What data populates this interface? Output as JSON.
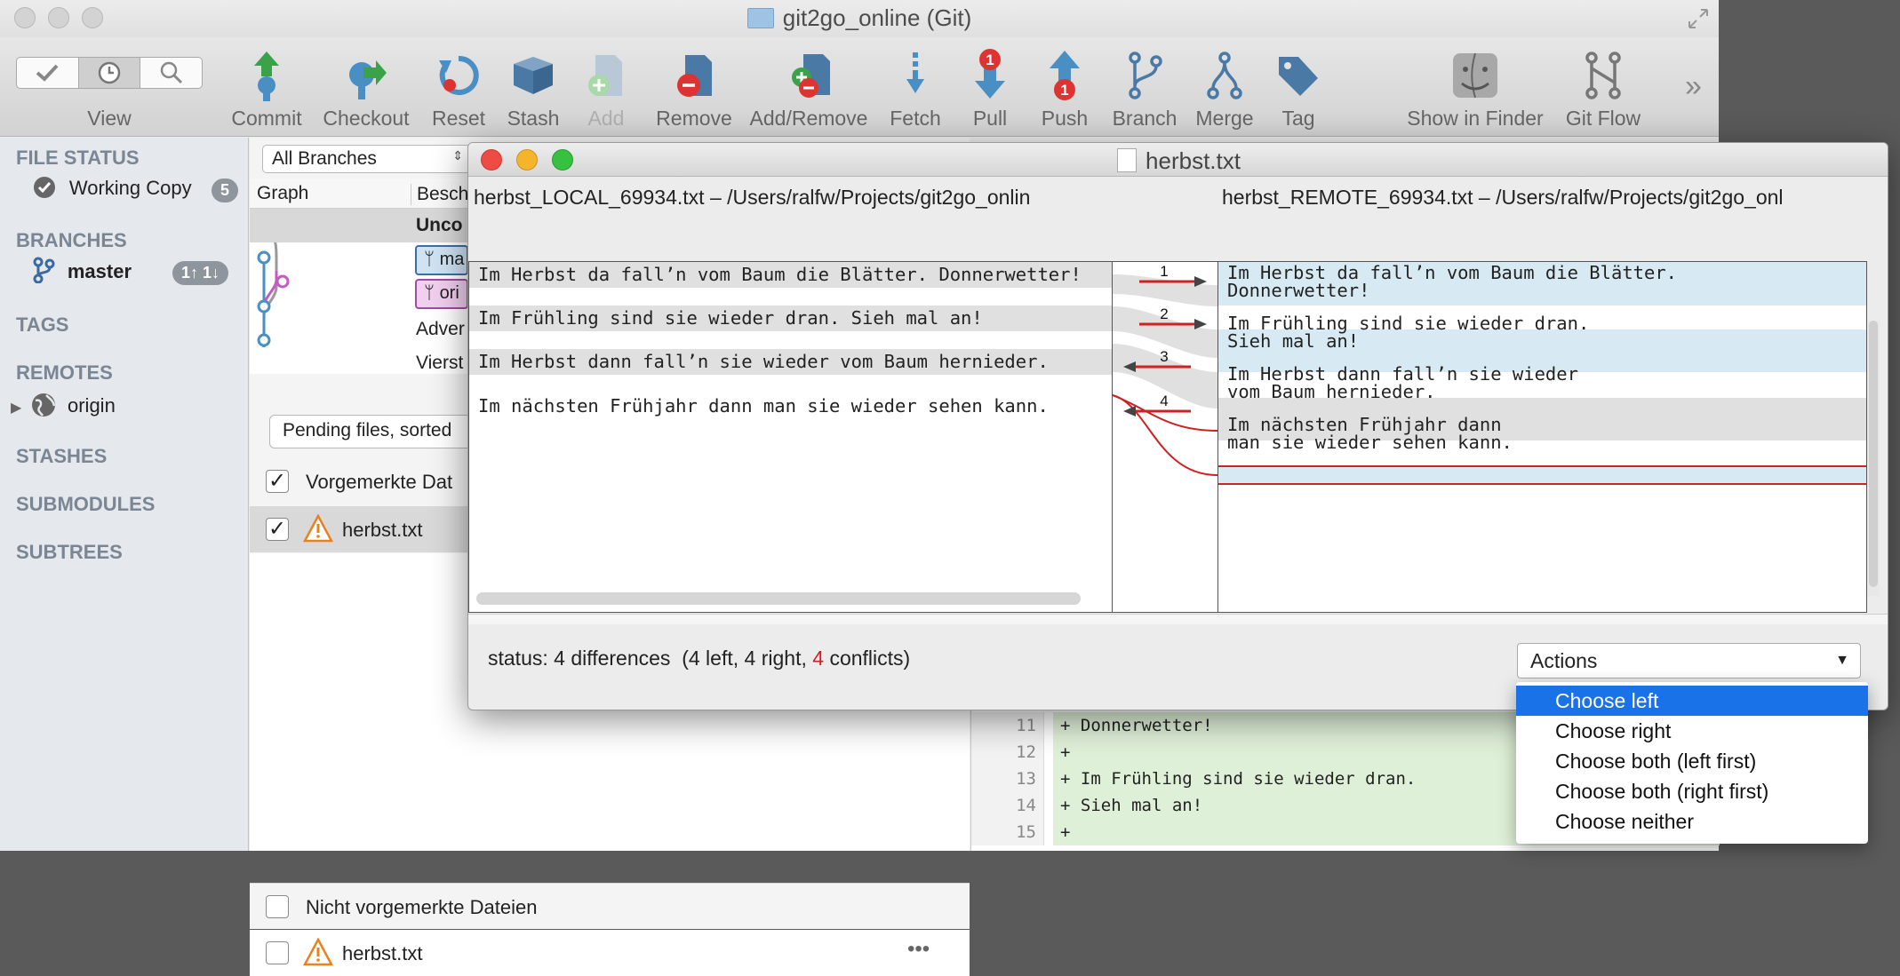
{
  "window": {
    "title": "git2go_online (Git)"
  },
  "toolbar": {
    "view_label": "View",
    "commit": "Commit",
    "checkout": "Checkout",
    "reset": "Reset",
    "stash": "Stash",
    "add": "Add",
    "remove": "Remove",
    "add_remove": "Add/Remove",
    "fetch": "Fetch",
    "pull": "Pull",
    "pull_badge": "1",
    "push": "Push",
    "push_badge": "1",
    "branch": "Branch",
    "merge": "Merge",
    "tag": "Tag",
    "show_in_finder": "Show in Finder",
    "git_flow": "Git Flow",
    "overflow": "»"
  },
  "sidebar": {
    "file_status": "FILE STATUS",
    "working_copy": "Working Copy",
    "working_copy_count": "5",
    "branches": "BRANCHES",
    "master": "master",
    "master_badge": "1↑ 1↓",
    "tags": "TAGS",
    "remotes": "REMOTES",
    "origin": "origin",
    "stashes": "STASHES",
    "submodules": "SUBMODULES",
    "subtrees": "SUBTREES"
  },
  "center": {
    "branch_filter": "All Branches",
    "col_graph": "Graph",
    "col_desc": "Besch",
    "rows": [
      "Unco",
      "ma",
      "ori",
      "Adver",
      "Vierst"
    ],
    "pending_button": "Pending files, sorted",
    "staged_header": "Vorgemerkte Dat",
    "staged_file": "herbst.txt",
    "unstaged_header": "Nicht vorgemerkte Dateien",
    "unstaged_file": "herbst.txt",
    "more": "•••"
  },
  "diff": {
    "lines": [
      {
        "num": "11",
        "text": "+ Donnerwetter!"
      },
      {
        "num": "12",
        "text": "+"
      },
      {
        "num": "13",
        "text": "+ Im Frühling sind sie wieder dran."
      },
      {
        "num": "14",
        "text": "+ Sieh mal an!"
      },
      {
        "num": "15",
        "text": "+"
      }
    ]
  },
  "merge": {
    "title": "herbst.txt",
    "left_path": "herbst_LOCAL_69934.txt – /Users/ralfw/Projects/git2go_onlin",
    "right_path": "herbst_REMOTE_69934.txt – /Users/ralfw/Projects/git2go_onl",
    "left_lines": [
      "Im Herbst da fall’n vom Baum die Blätter. Donnerwetter!",
      "Im Frühling sind sie wieder dran. Sieh mal an!",
      "Im Herbst dann fall’n sie wieder vom Baum hernieder.",
      "Im nächsten Frühjahr dann man sie wieder sehen kann."
    ],
    "right_lines": [
      "Im Herbst da fall’n vom Baum die Blätter.",
      "Donnerwetter!",
      "Im Frühling sind sie wieder dran.",
      "Sieh mal an!",
      "Im Herbst dann fall’n sie wieder",
      "vom Baum hernieder.",
      "Im nächsten Frühjahr dann",
      "man sie wieder sehen kann."
    ],
    "diff_numbers": [
      "1",
      "2",
      "3",
      "4"
    ],
    "status_prefix": "status:",
    "status_diffs": "4 differences",
    "status_left": "(4 left,",
    "status_right": "4 right,",
    "status_conflicts_num": "4",
    "status_conflicts": "conflicts)",
    "actions_label": "Actions",
    "menu": [
      "Choose left",
      "Choose right",
      "Choose both (left first)",
      "Choose both (right first)",
      "Choose neither"
    ]
  },
  "colors": {
    "accent": "#1a72e8",
    "conflict": "#cc2222",
    "added": "#dff0d8"
  }
}
